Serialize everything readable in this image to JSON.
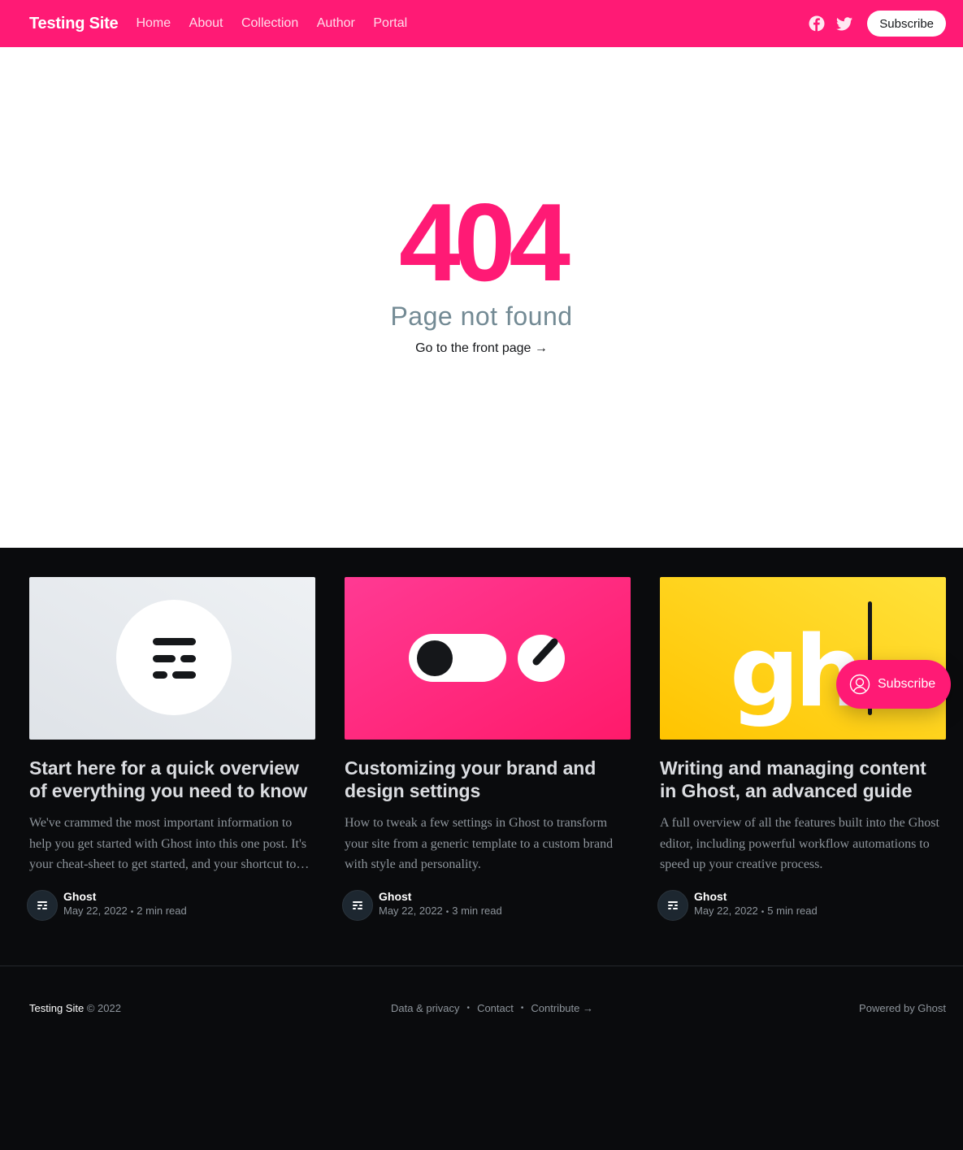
{
  "header": {
    "site_title": "Testing Site",
    "nav": [
      "Home",
      "About",
      "Collection",
      "Author",
      "Portal"
    ],
    "subscribe_label": "Subscribe",
    "brand_color": "#ff1a75"
  },
  "error": {
    "code": "404",
    "description": "Page not found",
    "link_label": "Go to the front page →"
  },
  "posts": [
    {
      "title": "Start here for a quick overview of everything you need to know",
      "excerpt": "We've crammed the most important information to help you get started with Ghost into this one post. It's your cheat-sheet to get started, and your shortcut to advanced features.",
      "author": "Ghost",
      "date": "May 22, 2022",
      "reading_time": "2 min read"
    },
    {
      "title": "Customizing your brand and design settings",
      "excerpt": "How to tweak a few settings in Ghost to transform your site from a generic template to a custom brand with style and personality.",
      "author": "Ghost",
      "date": "May 22, 2022",
      "reading_time": "3 min read"
    },
    {
      "title": "Writing and managing content in Ghost, an advanced guide",
      "excerpt": "A full overview of all the features built into the Ghost editor, including powerful workflow automations to speed up your creative process.",
      "author": "Ghost",
      "date": "May 22, 2022",
      "reading_time": "5 min read"
    }
  ],
  "footer": {
    "site_title": "Testing Site",
    "copyright": "© 2022",
    "nav": [
      "Data & privacy",
      "Contact",
      "Contribute →"
    ],
    "powered_by": "Powered by Ghost"
  },
  "portal": {
    "label": "Subscribe"
  }
}
